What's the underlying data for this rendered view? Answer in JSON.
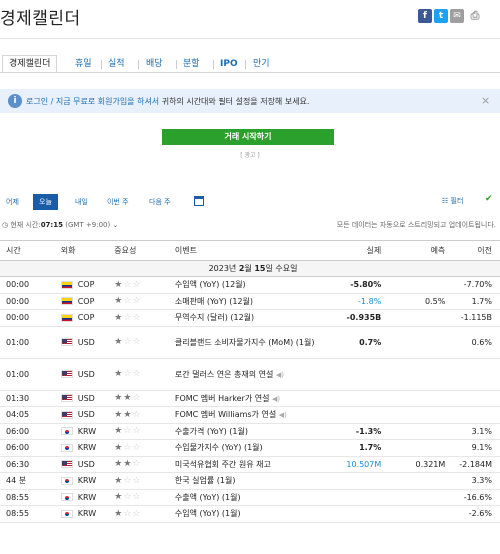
{
  "page": {
    "title": "경제캘린더"
  },
  "share": [
    {
      "icon": "facebook-icon",
      "glyph": "f",
      "color": "#3b5998"
    },
    {
      "icon": "twitter-icon",
      "glyph": "t",
      "color": "#1da1f2"
    },
    {
      "icon": "email-icon",
      "glyph": "✉",
      "color": "#9e9e9e"
    },
    {
      "icon": "print-icon",
      "glyph": "⎙",
      "color": "#ffffff"
    }
  ],
  "tabs": [
    "경제캘린더",
    "휴일",
    "실적",
    "배당",
    "분할",
    "IPO",
    "만기"
  ],
  "login_bar": {
    "link": "로그인 / 지금 무료로 회원가입을 하셔서",
    "text": " 귀하의 시간대와 필터 설정을 저장해 보세요.",
    "close": "×"
  },
  "trade_button": "거래 시작하기",
  "ad_label": "[ 광고 ]",
  "date_tabs": [
    "어제",
    "오늘",
    "내일",
    "이번 주",
    "다음 주"
  ],
  "filter_label": "필터",
  "clock": {
    "prefix": "현재 시간:",
    "time": "07:15",
    "tz": "(GMT +9:00)"
  },
  "stream_note": "모든 데이터는 자동으로 스트리밍되고 업데이트됩니다.",
  "columns": [
    "시간",
    "외화",
    "중요성",
    "이벤트",
    "실제",
    "예측",
    "이전"
  ],
  "date_row": {
    "pre": "2023년 ",
    "b1": "2",
    "mid": "월 ",
    "b2": "15",
    "post": "일 수요일"
  },
  "rows": [
    {
      "time": "00:00",
      "cur": "COP",
      "flag": "co",
      "imp": 1,
      "event": "수입액 (YoY) (12월)",
      "actual": "-5.80%",
      "actual_style": "bold",
      "forecast": "",
      "previous": "-7.70%"
    },
    {
      "time": "00:00",
      "cur": "COP",
      "flag": "co",
      "imp": 1,
      "event": "소매판매 (YoY) (12월)",
      "actual": "-1.8%",
      "actual_style": "blue",
      "forecast": "0.5%",
      "previous": "1.7%"
    },
    {
      "time": "00:00",
      "cur": "COP",
      "flag": "co",
      "imp": 1,
      "event": "무역수지 (달러) (12월)",
      "actual": "-0.935B",
      "actual_style": "bold",
      "forecast": "",
      "previous": "-1.115B"
    },
    {
      "time": "01:00",
      "cur": "USD",
      "flag": "us",
      "imp": 1,
      "event": "클리블랜드 소비자물가지수 (MoM) (1월)",
      "actual": "0.7%",
      "actual_style": "bold",
      "forecast": "",
      "previous": "0.6%",
      "tall": true
    },
    {
      "time": "01:00",
      "cur": "USD",
      "flag": "us",
      "imp": 1,
      "event": "로간 댈러스 연은 총재의 연설",
      "speech": true,
      "actual": "",
      "actual_style": "",
      "forecast": "",
      "previous": "",
      "tall": true
    },
    {
      "time": "01:30",
      "cur": "USD",
      "flag": "us",
      "imp": 2,
      "event": "FOMC 멤버 Harker가 연설",
      "speech": true,
      "actual": "",
      "actual_style": "",
      "forecast": "",
      "previous": ""
    },
    {
      "time": "04:05",
      "cur": "USD",
      "flag": "us",
      "imp": 2,
      "event": "FOMC 멤버 Williams가 연설",
      "speech": true,
      "actual": "",
      "actual_style": "",
      "forecast": "",
      "previous": ""
    },
    {
      "time": "06:00",
      "cur": "KRW",
      "flag": "kr",
      "imp": 1,
      "event": "수출가격 (YoY) (1월)",
      "actual": "-1.3%",
      "actual_style": "bold",
      "forecast": "",
      "previous": "3.1%"
    },
    {
      "time": "06:00",
      "cur": "KRW",
      "flag": "kr",
      "imp": 1,
      "event": "수입물가지수 (YoY) (1월)",
      "actual": "1.7%",
      "actual_style": "bold",
      "forecast": "",
      "previous": "9.1%"
    },
    {
      "time": "06:30",
      "cur": "USD",
      "flag": "us",
      "imp": 2,
      "event": "미국석유협회 주간 원유 재고",
      "actual": "10.507M",
      "actual_style": "blue",
      "forecast": "0.321M",
      "previous": "-2.184M"
    },
    {
      "time": "44 분",
      "cur": "KRW",
      "flag": "kr",
      "imp": 1,
      "event": "한국 실업률 (1월)",
      "actual": "",
      "actual_style": "",
      "forecast": "",
      "previous": "3.3%"
    },
    {
      "time": "08:55",
      "cur": "KRW",
      "flag": "kr",
      "imp": 1,
      "event": "수출액 (YoY) (1월)",
      "actual": "",
      "actual_style": "",
      "forecast": "",
      "previous": "-16.6%"
    },
    {
      "time": "08:55",
      "cur": "KRW",
      "flag": "kr",
      "imp": 1,
      "event": "수입액 (YoY) (1월)",
      "actual": "",
      "actual_style": "",
      "forecast": "",
      "previous": "-2.6%"
    }
  ]
}
